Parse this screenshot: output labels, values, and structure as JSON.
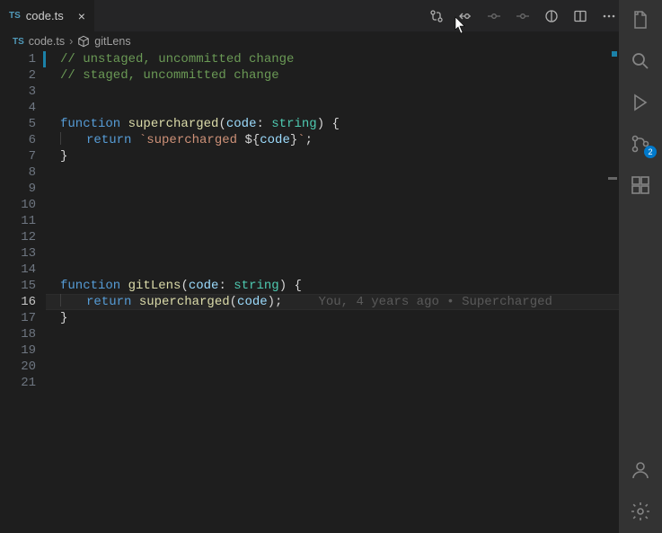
{
  "tab": {
    "icon_label": "TS",
    "filename": "code.ts"
  },
  "breadcrumb": {
    "icon_label": "TS",
    "filename": "code.ts",
    "symbol": "gitLens"
  },
  "activity": {
    "source_control_badge": "2"
  },
  "editor": {
    "current_line": 16,
    "lines": [
      {
        "n": 1,
        "tokens": [
          {
            "t": "// unstaged, uncommitted change",
            "c": "tok-comment"
          }
        ],
        "git": "unstaged"
      },
      {
        "n": 2,
        "tokens": [
          {
            "t": "// staged, uncommitted change",
            "c": "tok-comment"
          }
        ]
      },
      {
        "n": 3,
        "tokens": []
      },
      {
        "n": 4,
        "tokens": []
      },
      {
        "n": 5,
        "tokens": [
          {
            "t": "function ",
            "c": "tok-keyword"
          },
          {
            "t": "supercharged",
            "c": "tok-func"
          },
          {
            "t": "(",
            "c": "tok-punc"
          },
          {
            "t": "code",
            "c": "tok-param"
          },
          {
            "t": ": ",
            "c": "tok-punc"
          },
          {
            "t": "string",
            "c": "tok-type"
          },
          {
            "t": ") {",
            "c": "tok-punc"
          }
        ]
      },
      {
        "n": 6,
        "indent": true,
        "tokens": [
          {
            "t": "return ",
            "c": "tok-keyword"
          },
          {
            "t": "`supercharged ",
            "c": "tok-string"
          },
          {
            "t": "${",
            "c": "tok-punc"
          },
          {
            "t": "code",
            "c": "tok-var"
          },
          {
            "t": "}",
            "c": "tok-punc"
          },
          {
            "t": "`",
            "c": "tok-string"
          },
          {
            "t": ";",
            "c": "tok-punc"
          }
        ]
      },
      {
        "n": 7,
        "tokens": [
          {
            "t": "}",
            "c": "tok-punc"
          }
        ]
      },
      {
        "n": 8,
        "tokens": []
      },
      {
        "n": 9,
        "tokens": []
      },
      {
        "n": 10,
        "tokens": []
      },
      {
        "n": 11,
        "tokens": []
      },
      {
        "n": 12,
        "tokens": []
      },
      {
        "n": 13,
        "tokens": []
      },
      {
        "n": 14,
        "tokens": []
      },
      {
        "n": 15,
        "tokens": [
          {
            "t": "function ",
            "c": "tok-keyword"
          },
          {
            "t": "gitLens",
            "c": "tok-func"
          },
          {
            "t": "(",
            "c": "tok-punc"
          },
          {
            "t": "code",
            "c": "tok-param"
          },
          {
            "t": ": ",
            "c": "tok-punc"
          },
          {
            "t": "string",
            "c": "tok-type"
          },
          {
            "t": ") {",
            "c": "tok-punc"
          }
        ]
      },
      {
        "n": 16,
        "indent": true,
        "tokens": [
          {
            "t": "return ",
            "c": "tok-keyword"
          },
          {
            "t": "supercharged",
            "c": "tok-func"
          },
          {
            "t": "(",
            "c": "tok-punc"
          },
          {
            "t": "code",
            "c": "tok-var"
          },
          {
            "t": ");",
            "c": "tok-punc"
          }
        ],
        "lens": "You, 4 years ago • Supercharged"
      },
      {
        "n": 17,
        "tokens": [
          {
            "t": "}",
            "c": "tok-punc"
          }
        ]
      },
      {
        "n": 18,
        "tokens": []
      },
      {
        "n": 19,
        "tokens": []
      },
      {
        "n": 20,
        "tokens": []
      },
      {
        "n": 21,
        "tokens": []
      }
    ]
  }
}
